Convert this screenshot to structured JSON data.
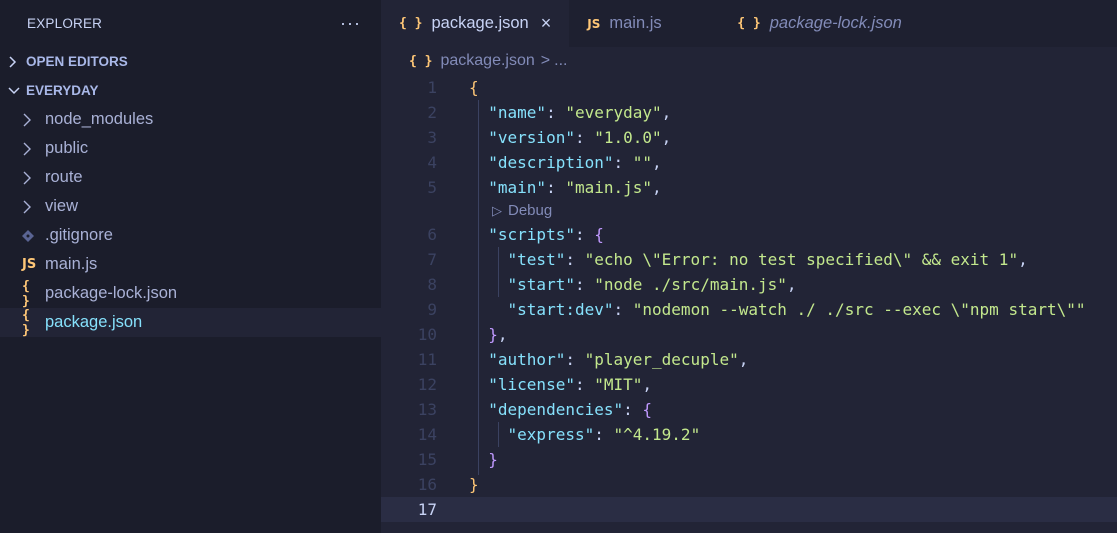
{
  "explorer": {
    "title": "EXPLORER",
    "more_label": "···",
    "sections": {
      "open_editors": "OPEN EDITORS",
      "project": "EVERYDAY"
    },
    "items": [
      {
        "label": "node_modules",
        "kind": "folder"
      },
      {
        "label": "public",
        "kind": "folder"
      },
      {
        "label": "route",
        "kind": "folder"
      },
      {
        "label": "view",
        "kind": "folder"
      },
      {
        "label": ".gitignore",
        "kind": "git"
      },
      {
        "label": "main.js",
        "kind": "js"
      },
      {
        "label": "package-lock.json",
        "kind": "json"
      },
      {
        "label": "package.json",
        "kind": "json",
        "active": true
      }
    ]
  },
  "icons": {
    "json": "{ }",
    "js": "JS",
    "chevron_right": "chevron-right-icon",
    "chevron_down": "chevron-down-icon",
    "git": "git-diamond-icon",
    "close": "×",
    "play": "▷"
  },
  "tabs": [
    {
      "label": "package.json",
      "icon": "json",
      "active": true
    },
    {
      "label": "main.js",
      "icon": "js"
    },
    {
      "label": "package-lock.json",
      "icon": "json",
      "italic": true
    }
  ],
  "breadcrumb": {
    "file": "package.json",
    "separator": ">",
    "rest": "..."
  },
  "codelens": {
    "debug_label": "Debug"
  },
  "line_numbers": [
    "1",
    "2",
    "3",
    "4",
    "5",
    "6",
    "7",
    "8",
    "9",
    "10",
    "11",
    "12",
    "13",
    "14",
    "15",
    "16",
    "17"
  ],
  "current_line": "17",
  "colors": {
    "key": "#86e1fc",
    "string": "#c3e88d",
    "brace_outer": "#ffc777",
    "brace_inner": "#c099ff",
    "active_file": "#86e1fc"
  },
  "code": {
    "l1": "{",
    "l2": {
      "key": "\"name\"",
      "val": "\"everyday\""
    },
    "l3": {
      "key": "\"version\"",
      "val": "\"1.0.0\""
    },
    "l4": {
      "key": "\"description\"",
      "val": "\"\""
    },
    "l5": {
      "key": "\"main\"",
      "val": "\"main.js\""
    },
    "l6": {
      "key": "\"scripts\"",
      "open": "{"
    },
    "l7": {
      "key": "\"test\"",
      "val": "\"echo \\\"Error: no test specified\\\" && exit 1\""
    },
    "l8": {
      "key": "\"start\"",
      "val": "\"node ./src/main.js\""
    },
    "l9": {
      "key": "\"start:dev\"",
      "val": "\"nodemon --watch ./ ./src --exec \\\"npm start\\\"\""
    },
    "l10": "}",
    "l11": {
      "key": "\"author\"",
      "val": "\"player_decuple\""
    },
    "l12": {
      "key": "\"license\"",
      "val": "\"MIT\""
    },
    "l13": {
      "key": "\"dependencies\"",
      "open": "{"
    },
    "l14": {
      "key": "\"express\"",
      "val": "\"^4.19.2\""
    },
    "l15": "}",
    "l16": "}"
  }
}
